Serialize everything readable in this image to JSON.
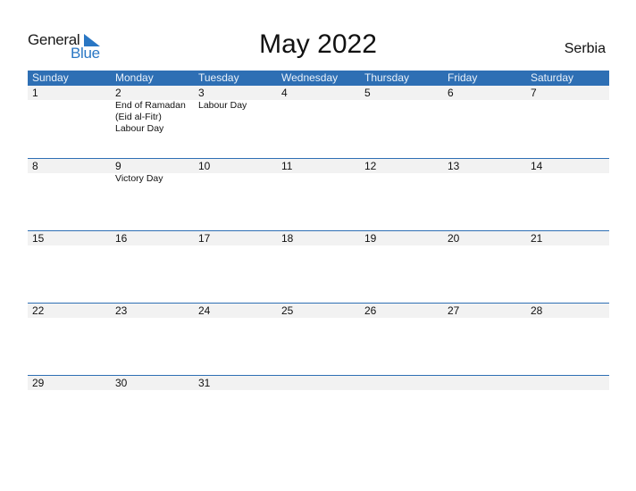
{
  "logo": {
    "part1": "General",
    "part2": "Blue"
  },
  "header": {
    "title": "May 2022",
    "country": "Serbia"
  },
  "colors": {
    "accent": "#2e6fb4",
    "row_bg": "#f2f2f2"
  },
  "weekdays": [
    "Sunday",
    "Monday",
    "Tuesday",
    "Wednesday",
    "Thursday",
    "Friday",
    "Saturday"
  ],
  "weeks": [
    {
      "days": [
        "1",
        "2",
        "3",
        "4",
        "5",
        "6",
        "7"
      ],
      "events": [
        "",
        "End of Ramadan\n(Eid al-Fitr)\n  Labour Day",
        "Labour Day",
        "",
        "",
        "",
        ""
      ]
    },
    {
      "days": [
        "8",
        "9",
        "10",
        "11",
        "12",
        "13",
        "14"
      ],
      "events": [
        "",
        "Victory Day",
        "",
        "",
        "",
        "",
        ""
      ]
    },
    {
      "days": [
        "15",
        "16",
        "17",
        "18",
        "19",
        "20",
        "21"
      ],
      "events": [
        "",
        "",
        "",
        "",
        "",
        "",
        ""
      ]
    },
    {
      "days": [
        "22",
        "23",
        "24",
        "25",
        "26",
        "27",
        "28"
      ],
      "events": [
        "",
        "",
        "",
        "",
        "",
        "",
        ""
      ]
    },
    {
      "days": [
        "29",
        "30",
        "31",
        "",
        "",
        "",
        ""
      ],
      "events": [
        "",
        "",
        "",
        "",
        "",
        "",
        ""
      ]
    }
  ]
}
